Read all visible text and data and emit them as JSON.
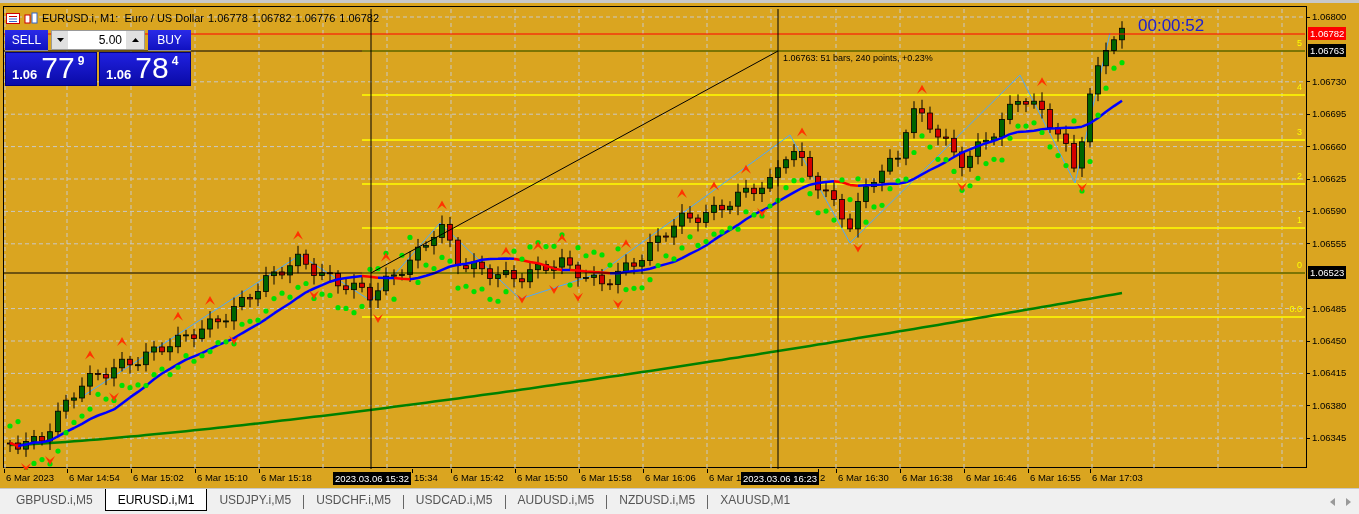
{
  "chart": {
    "symbol_line": "EURUSD.i, M1:  Euro / US Dollar",
    "ohlc": [
      "1.06778",
      "1.06782",
      "1.06776",
      "1.06782"
    ],
    "timer": "00:00:52",
    "measure_label": "1.06763: 51 bars, 240 points, +0.23%",
    "price_ticks": [
      "1.06800",
      "1.06730",
      "1.06695",
      "1.06660",
      "1.06625",
      "1.06590",
      "1.06555",
      "1.06485",
      "1.06450",
      "1.06415",
      "1.06380",
      "1.06345"
    ],
    "price_tags": [
      {
        "text": "1.06782",
        "kind": "bid"
      },
      {
        "text": "1.06763",
        "kind": "crosshair"
      },
      {
        "text": "1.06523",
        "kind": "crosshair"
      }
    ],
    "fib_levels": [
      "5",
      "4",
      "3",
      "2",
      "1",
      "0",
      "0.0"
    ],
    "time_labels": [
      "6 Mar 2023",
      "6 Mar 14:54",
      "6 Mar 15:02",
      "6 Mar 15:10",
      "6 Mar 15:18",
      "15:34",
      "6 Mar 15:42",
      "6 Mar 15:50",
      "6 Mar 15:58",
      "6 Mar 16:06",
      "6 Mar 1",
      "2",
      "6 Mar 16:30",
      "6 Mar 16:38",
      "6 Mar 16:46",
      "6 Mar 16:55",
      "6 Mar 17:03"
    ],
    "crosshair_times": [
      "2023.03.06 15:32",
      "2023.03.06 16:23"
    ]
  },
  "trade_panel": {
    "sell_label": "SELL",
    "buy_label": "BUY",
    "volume": "5.00",
    "sell_price": {
      "prefix": "1.06",
      "big": "77",
      "sup": "9"
    },
    "buy_price": {
      "prefix": "1.06",
      "big": "78",
      "sup": "4"
    }
  },
  "tabs": [
    {
      "label": "GBPUSD.i,M5",
      "selected": false
    },
    {
      "label": "EURUSD.i,M1",
      "selected": true
    },
    {
      "label": "USDJPY.i,M5",
      "selected": false
    },
    {
      "label": "USDCHF.i,M5",
      "selected": false
    },
    {
      "label": "USDCAD.i,M5",
      "selected": false
    },
    {
      "label": "AUDUSD.i,M5",
      "selected": false
    },
    {
      "label": "NZDUSD.i,M5",
      "selected": false
    },
    {
      "label": "XAUUSD,M1",
      "selected": false
    }
  ]
}
